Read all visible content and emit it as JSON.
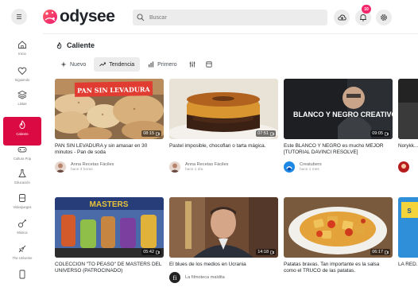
{
  "header": {
    "logo_text": "odysee",
    "search_placeholder": "Buscar",
    "notification_count": "10"
  },
  "sidebar": {
    "items": [
      {
        "label": "Inicio",
        "icon": "home-icon"
      },
      {
        "label": "Siguiendo",
        "icon": "heart-icon"
      },
      {
        "label": "Listas",
        "icon": "stack-icon"
      },
      {
        "label": "Caliente",
        "icon": "flame-icon",
        "active": true
      },
      {
        "label": "Cultura Pop",
        "icon": "gamepad-icon"
      },
      {
        "label": "Educación",
        "icon": "flask-icon"
      },
      {
        "label": "Videojuegos",
        "icon": "controller-icon"
      },
      {
        "label": "Música",
        "icon": "guitar-icon"
      },
      {
        "label": "The Universe",
        "icon": "satellite-icon"
      },
      {
        "label": "",
        "icon": "device-icon"
      }
    ]
  },
  "main": {
    "section_title": "Caliente",
    "tabs": [
      {
        "label": "Nuevo",
        "icon": "sparkle-icon"
      },
      {
        "label": "Tendencia",
        "icon": "trend-icon",
        "selected": true
      },
      {
        "label": "Primero",
        "icon": "bars-icon"
      }
    ]
  },
  "cards": [
    {
      "thumb_text": "PAN SIN LEVADURA",
      "duration": "08:15",
      "title": "PAN SIN LEVADURA y sin amasar en 30 minutos - Pan de soda",
      "channel": "Anna Recetas Fáciles",
      "time": "hace 3 horas"
    },
    {
      "thumb_text": "",
      "duration": "07:51",
      "title": "Pastel imposible, chocoflan o tarta mágica.",
      "channel": "Anna Recetas Fáciles",
      "time": "hace 1 día"
    },
    {
      "thumb_text": "BLANCO Y NEGRO CREATIVO",
      "duration": "09:05",
      "title": "Este BLANCO Y NEGRO es mucho MEJOR [TUTORIAL DAVINCI RESOLVE]",
      "channel": "Creatubers",
      "time": "hace 1 mes"
    },
    {
      "thumb_text": "",
      "duration": "",
      "title": "Norykk... canal d...",
      "channel": "",
      "time": ""
    },
    {
      "thumb_text": "",
      "duration": "05:42",
      "title": "COLECCIÓN \"TO PEASO\" DE MASTERS DEL UNIVERSO (PATROCINADO)",
      "channel": "",
      "time": ""
    },
    {
      "thumb_text": "",
      "duration": "14:18",
      "title": "El blues de los medios en Ucrania",
      "channel": "La filmoteca maldita",
      "time": ""
    },
    {
      "thumb_text": "",
      "duration": "06:17",
      "title": "Patatas bravas. Tan importante es la salsa como el TRUCO de las patatas.",
      "channel": "",
      "time": ""
    },
    {
      "thumb_text": "",
      "duration": "",
      "title": "LA RED...",
      "channel": "",
      "time": ""
    }
  ],
  "colors": {
    "accent": "#dc0a43",
    "badge": "#f3266b",
    "header_bg": "#ffffff",
    "chip_bg": "#ececec"
  }
}
